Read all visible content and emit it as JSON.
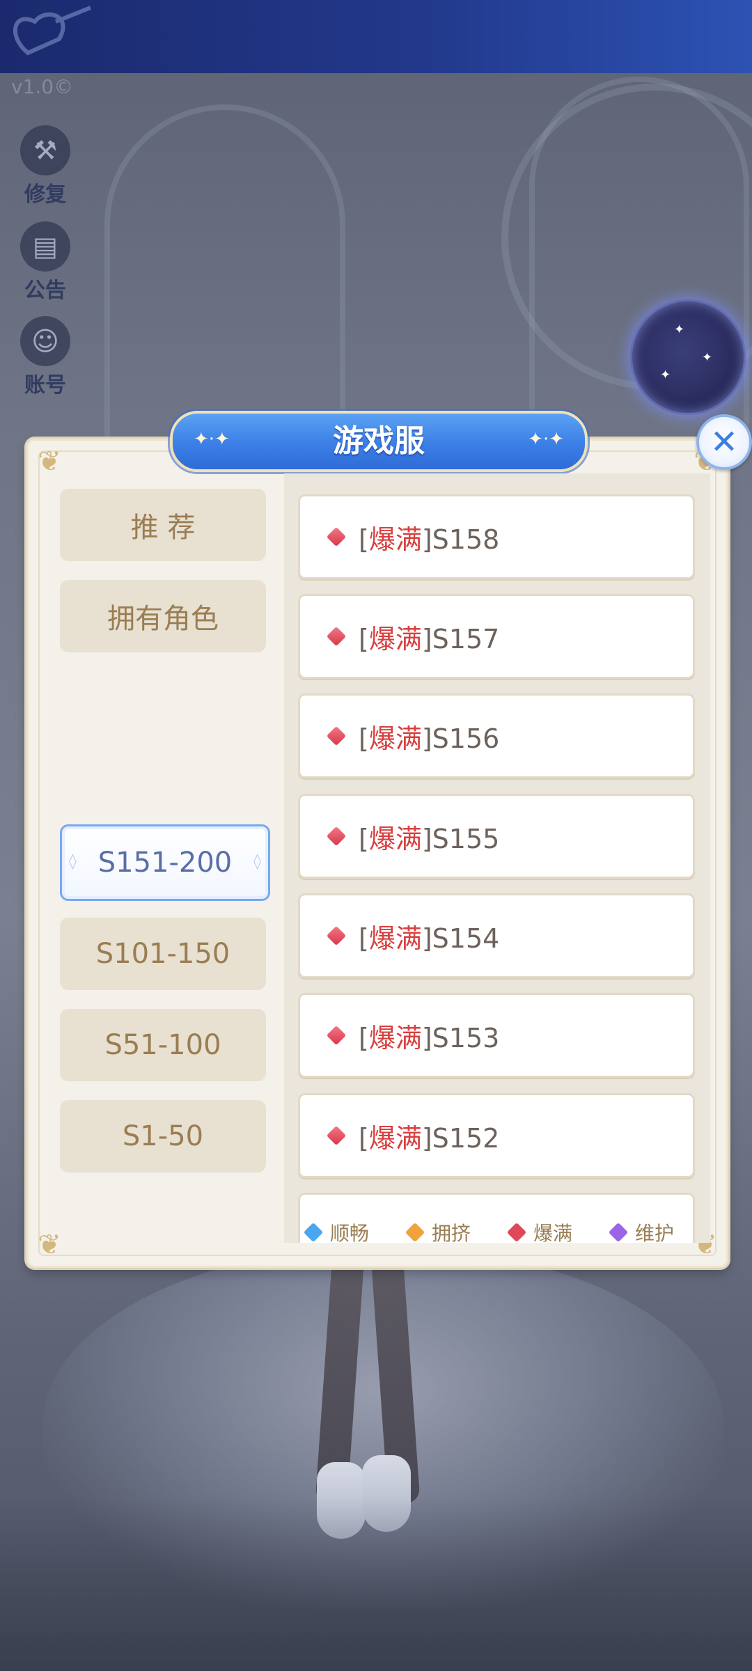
{
  "version": "v1.0©",
  "side_menu": [
    {
      "label": "修复",
      "icon": "wrench-icon"
    },
    {
      "label": "公告",
      "icon": "calendar-icon"
    },
    {
      "label": "账号",
      "icon": "account-icon"
    }
  ],
  "dialog": {
    "title": "游戏服",
    "close_icon": "close-icon"
  },
  "categories": [
    {
      "label": "推 荐",
      "selected": false
    },
    {
      "label": "拥有角色",
      "selected": false
    },
    {
      "label": "S151-200",
      "selected": true
    },
    {
      "label": "S101-150",
      "selected": false
    },
    {
      "label": "S51-100",
      "selected": false
    },
    {
      "label": "S1-50",
      "selected": false
    }
  ],
  "servers": [
    {
      "bracket_open": "[",
      "status": "爆满",
      "bracket_close": "]",
      "name": "S158"
    },
    {
      "bracket_open": "[",
      "status": "爆满",
      "bracket_close": "]",
      "name": "S157"
    },
    {
      "bracket_open": "[",
      "status": "爆满",
      "bracket_close": "]",
      "name": "S156"
    },
    {
      "bracket_open": "[",
      "status": "爆满",
      "bracket_close": "]",
      "name": "S155"
    },
    {
      "bracket_open": "[",
      "status": "爆满",
      "bracket_close": "]",
      "name": "S154"
    },
    {
      "bracket_open": "[",
      "status": "爆满",
      "bracket_close": "]",
      "name": "S153"
    },
    {
      "bracket_open": "[",
      "status": "爆满",
      "bracket_close": "]",
      "name": "S152"
    }
  ],
  "legend": [
    {
      "label": "顺畅",
      "color": "#4aa6ee"
    },
    {
      "label": "拥挤",
      "color": "#f0a23c"
    },
    {
      "label": "爆满",
      "color": "#e0485a"
    },
    {
      "label": "维护",
      "color": "#9b63e6"
    }
  ],
  "colors": {
    "status_full": "#d8403f",
    "accent_blue": "#3b7fe6",
    "tab_text": "#9a7d53"
  }
}
